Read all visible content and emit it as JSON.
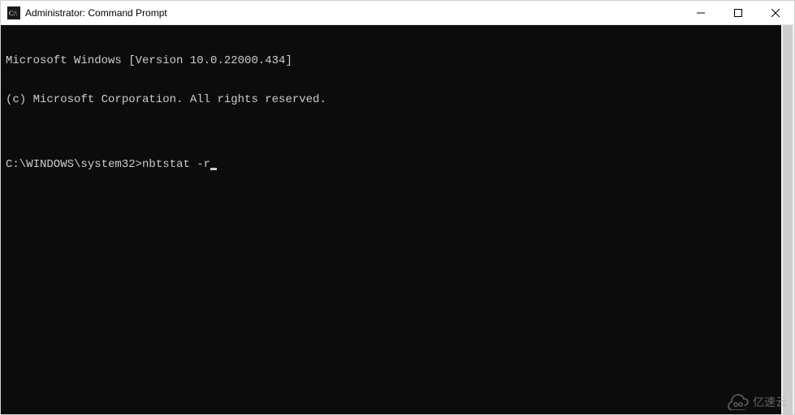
{
  "window": {
    "title": "Administrator: Command Prompt"
  },
  "terminal": {
    "line1": "Microsoft Windows [Version 10.0.22000.434]",
    "line2": "(c) Microsoft Corporation. All rights reserved.",
    "blank": "",
    "prompt": "C:\\WINDOWS\\system32>",
    "command": "nbtstat -r"
  },
  "watermark": {
    "text": "亿速云"
  }
}
